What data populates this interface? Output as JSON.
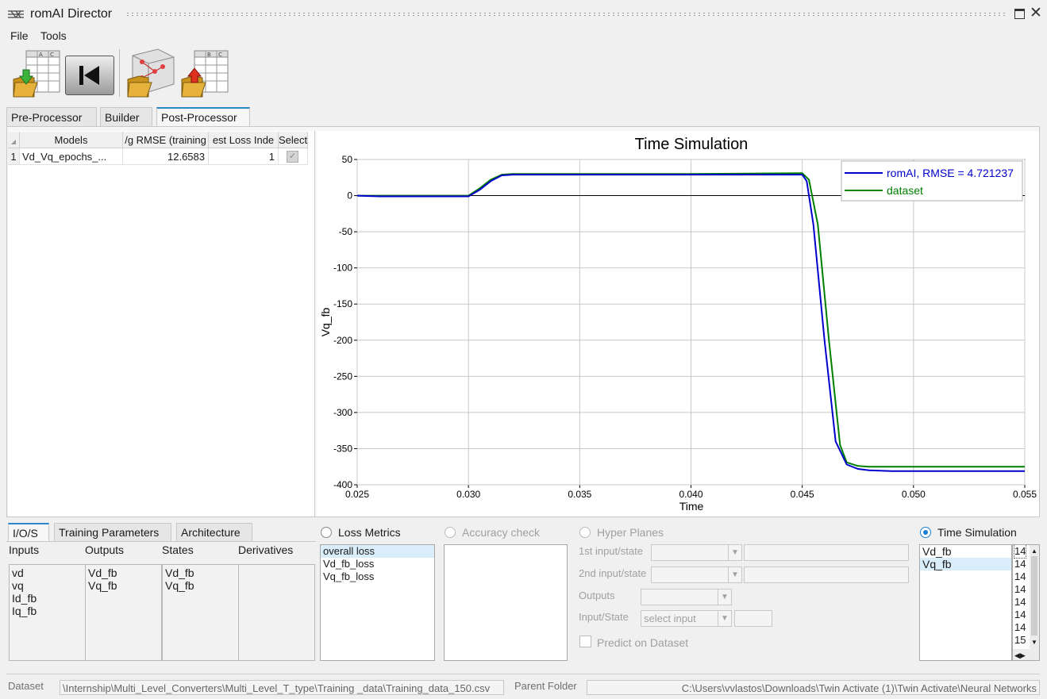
{
  "window": {
    "title": "romAI Director"
  },
  "menu": {
    "file": "File",
    "tools": "Tools"
  },
  "tabs": {
    "pre": "Pre-Processor",
    "builder": "Builder",
    "post": "Post-Processor"
  },
  "models_table": {
    "headers": [
      "Models",
      "/g RMSE (training",
      "est Loss Inde",
      "Select"
    ],
    "rows": [
      {
        "index": "1",
        "model": "Vd_Vq_epochs_...",
        "rmse": "12.6583",
        "loss_index": "1",
        "selected": true
      }
    ]
  },
  "chart_data": {
    "type": "line",
    "title": "Time Simulation",
    "xlabel": "Time",
    "ylabel": "Vq_fb",
    "xlim": [
      0.025,
      0.055
    ],
    "ylim": [
      -400,
      50
    ],
    "xticks": [
      "0.025",
      "0.030",
      "0.035",
      "0.040",
      "0.045",
      "0.050",
      "0.055"
    ],
    "yticks": [
      "50",
      "0",
      "-50",
      "-100",
      "-150",
      "-200",
      "-250",
      "-300",
      "-350",
      "-400"
    ],
    "legend_position": "top-right",
    "grid": true,
    "series": [
      {
        "name": "romAI, RMSE = 4.721237",
        "color": "#0000cc",
        "x": [
          0.025,
          0.026,
          0.03,
          0.0305,
          0.031,
          0.0315,
          0.032,
          0.035,
          0.04,
          0.045,
          0.0452,
          0.0455,
          0.046,
          0.0465,
          0.047,
          0.0475,
          0.048,
          0.049,
          0.055
        ],
        "y": [
          0,
          -1,
          -1,
          8,
          20,
          28,
          29,
          29,
          29,
          29,
          20,
          -40,
          -200,
          -340,
          -372,
          -378,
          -380,
          -381,
          -381
        ]
      },
      {
        "name": "dataset",
        "color": "#008000",
        "x": [
          0.025,
          0.026,
          0.03,
          0.0305,
          0.031,
          0.0315,
          0.032,
          0.035,
          0.04,
          0.045,
          0.0453,
          0.0457,
          0.0462,
          0.0467,
          0.047,
          0.0475,
          0.048,
          0.049,
          0.055
        ],
        "y": [
          0,
          0,
          0,
          10,
          22,
          29,
          30,
          30,
          30,
          31,
          22,
          -40,
          -200,
          -345,
          -369,
          -374,
          -375,
          -375,
          -375
        ]
      }
    ]
  },
  "bottom_tabs": {
    "ios": "I/O/S",
    "training": "Training Parameters",
    "architecture": "Architecture"
  },
  "ios": {
    "headers": {
      "inputs": "Inputs",
      "outputs": "Outputs",
      "states": "States",
      "derivatives": "Derivatives"
    },
    "inputs": [
      "vd",
      "vq",
      "Id_fb",
      "Iq_fb"
    ],
    "outputs": [
      "Vd_fb",
      "Vq_fb"
    ],
    "states": [
      "Vd_fb",
      "Vq_fb"
    ],
    "derivatives": []
  },
  "loss_metrics": {
    "label": "Loss Metrics",
    "items": [
      "overall loss",
      "Vd_fb_loss",
      "Vq_fb_loss"
    ],
    "selected": 0
  },
  "accuracy": {
    "label": "Accuracy check"
  },
  "hyper_planes": {
    "label": "Hyper Planes",
    "first": "1st input/state",
    "second": "2nd input/state",
    "outputs": "Outputs",
    "input_state": "Input/State",
    "select_placeholder": "select input",
    "predict": "Predict on Dataset"
  },
  "time_sim": {
    "label": "Time Simulation",
    "items": [
      "Vd_fb",
      "Vq_fb"
    ],
    "selected": 1,
    "numbers": [
      "14",
      "14",
      "14",
      "14",
      "14",
      "14",
      "14",
      "15"
    ]
  },
  "status": {
    "dataset_label": "Dataset",
    "dataset_path": "\\Internship\\Multi_Level_Converters\\Multi_Level_T_type\\Training _data\\Training_data_150.csv",
    "parent_label": "Parent Folder",
    "parent_path": "C:\\Users\\vvlastos\\Downloads\\Twin Activate (1)\\Twin Activate\\Neural Networks"
  }
}
